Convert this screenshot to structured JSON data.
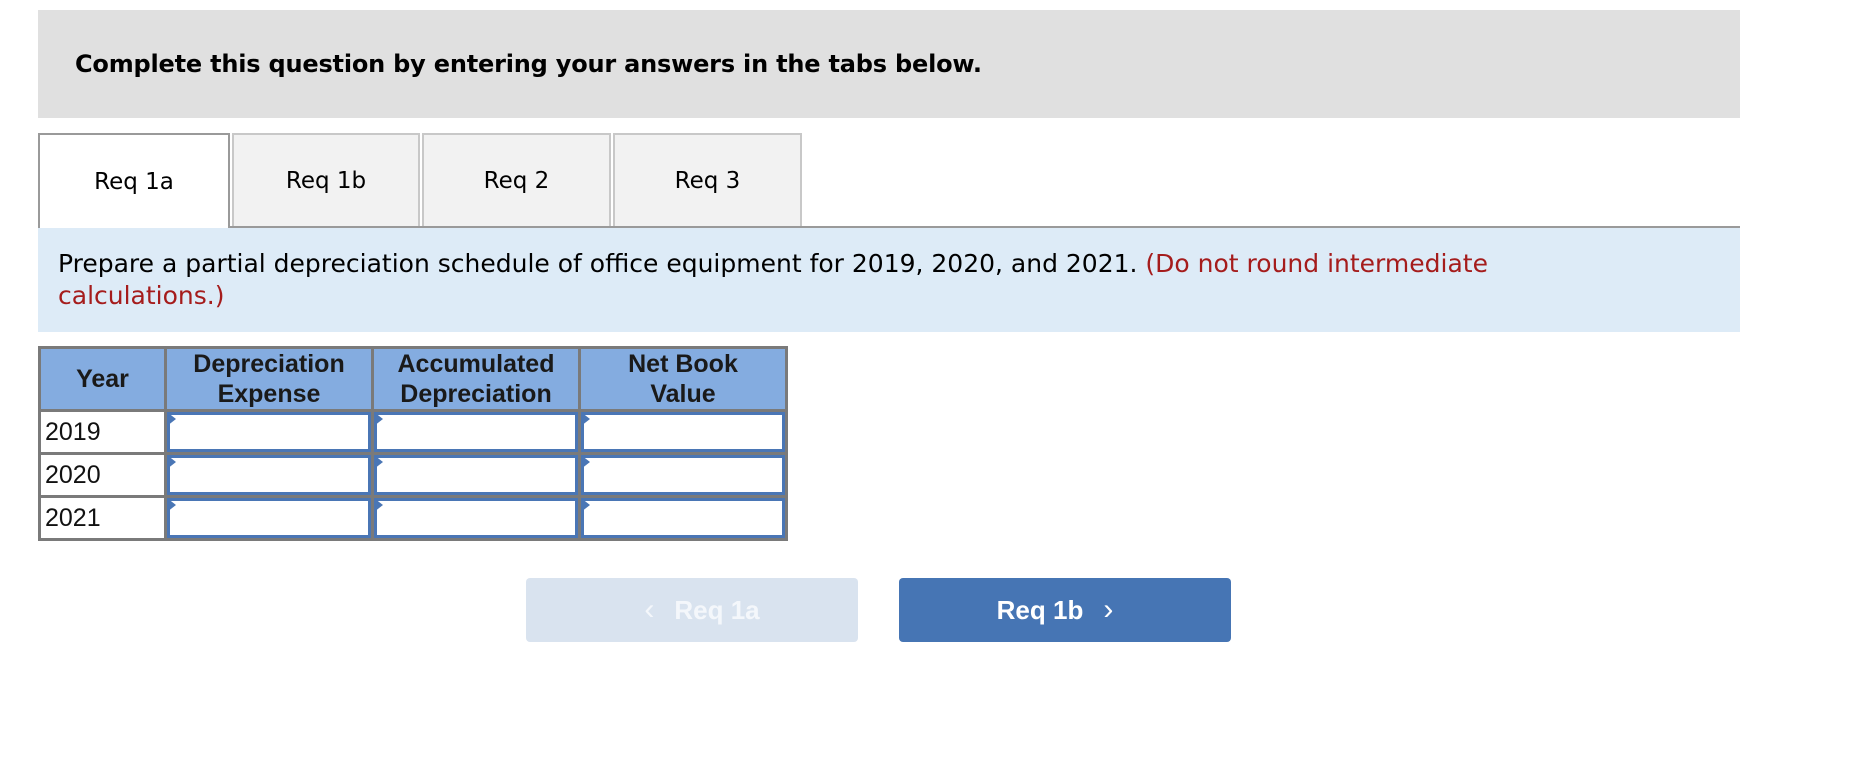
{
  "header": {
    "instruction": "Complete this question by entering your answers in the tabs below."
  },
  "tabs": [
    {
      "label": "Req 1a",
      "active": true
    },
    {
      "label": "Req 1b",
      "active": false
    },
    {
      "label": "Req 2",
      "active": false
    },
    {
      "label": "Req 3",
      "active": false
    }
  ],
  "question": {
    "text": "Prepare a partial depreciation schedule of office equipment for 2019, 2020, and 2021.",
    "note": "(Do not round intermediate calculations.)"
  },
  "table": {
    "headers": [
      "Year",
      "Depreciation Expense",
      "Accumulated Depreciation",
      "Net Book Value"
    ],
    "header_lines": [
      [
        "Year"
      ],
      [
        "Depreciation",
        "Expense"
      ],
      [
        "Accumulated",
        "Depreciation"
      ],
      [
        "Net Book",
        "Value"
      ]
    ],
    "rows": [
      {
        "year": "2019",
        "depreciation_expense": "",
        "accumulated_depreciation": "",
        "net_book_value": ""
      },
      {
        "year": "2020",
        "depreciation_expense": "",
        "accumulated_depreciation": "",
        "net_book_value": ""
      },
      {
        "year": "2021",
        "depreciation_expense": "",
        "accumulated_depreciation": "",
        "net_book_value": ""
      }
    ]
  },
  "nav": {
    "prev_label": "Req 1a",
    "prev_icon": "chevron-left-icon",
    "prev_glyph": "‹",
    "next_label": "Req 1b",
    "next_icon": "chevron-right-icon",
    "next_glyph": "›"
  },
  "colors": {
    "accent": "#4675b4",
    "header_fill": "#84ace0",
    "note": "#a51c1c",
    "question_bg": "#ddebf7"
  }
}
